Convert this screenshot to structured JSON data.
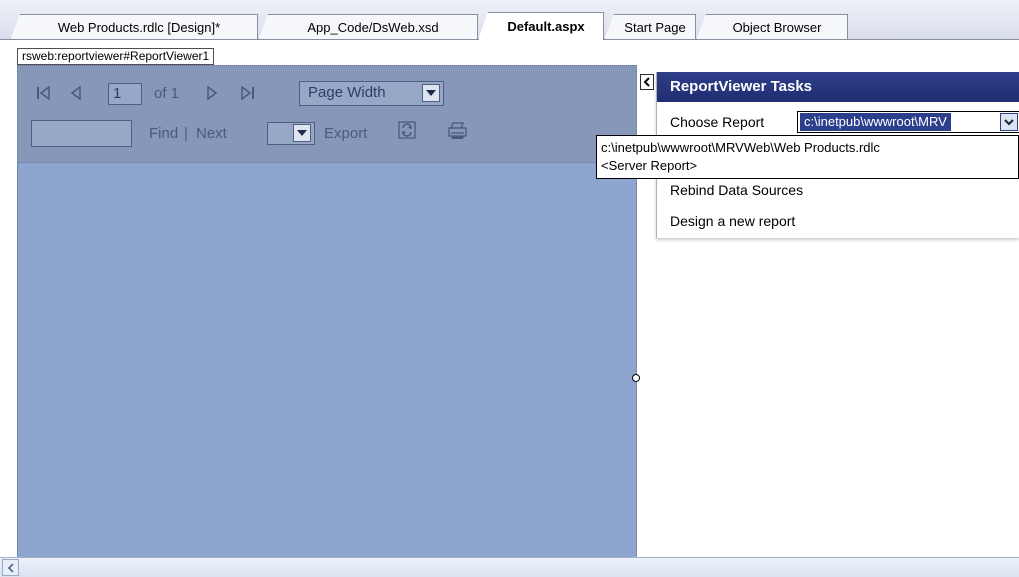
{
  "tabs": [
    {
      "label": "Web Products.rdlc [Design]*",
      "active": false
    },
    {
      "label": "App_Code/DsWeb.xsd",
      "active": false
    },
    {
      "label": "Default.aspx",
      "active": true
    },
    {
      "label": "Start Page",
      "active": false
    },
    {
      "label": "Object Browser",
      "active": false
    }
  ],
  "control_tag": "rsweb:reportviewer#ReportViewer1",
  "toolbar": {
    "page_number": "1",
    "page_of": "of 1",
    "zoom": "Page Width",
    "find_label": "Find",
    "separator": "|",
    "next_label": "Next",
    "export_label": "Export",
    "icons": [
      "first-page-icon",
      "previous-page-icon",
      "next-page-icon",
      "last-page-icon",
      "refresh-icon",
      "print-icon"
    ]
  },
  "tasks_panel": {
    "title": "ReportViewer Tasks",
    "choose_report_label": "Choose Report",
    "selected_report": "c:\\inetpub\\wwwroot\\MRV",
    "options": [
      "c:\\inetpub\\wwwroot\\MRVWeb\\Web Products.rdlc",
      "<Server Report>"
    ],
    "rebind_label": "Rebind Data Sources",
    "design_new_label": "Design a new report"
  },
  "colors": {
    "viewer_background": "#8ea5cf",
    "toolbar_background": "#8797ba",
    "tasks_header": "#2e3f89"
  }
}
